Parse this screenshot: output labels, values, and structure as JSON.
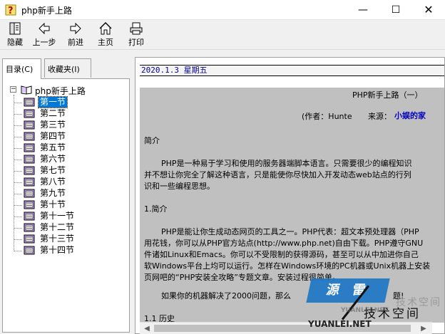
{
  "window": {
    "title": "php新手上路",
    "controls": {
      "minimize": "—",
      "maximize": "☐",
      "close": "✕"
    }
  },
  "toolbar": {
    "items": [
      {
        "label": "隐藏",
        "icon": "hide-pane-icon"
      },
      {
        "label": "上一步",
        "icon": "back-arrow-icon"
      },
      {
        "label": "前进",
        "icon": "forward-arrow-icon"
      },
      {
        "label": "主页",
        "icon": "home-icon"
      },
      {
        "label": "打印",
        "icon": "print-icon"
      }
    ]
  },
  "tabs": {
    "contents": "目录(C)",
    "favorites": "收藏夹(I)"
  },
  "tree": {
    "root": "php新手上路",
    "expander": "−",
    "items": [
      "第一节",
      "第二节",
      "第三节",
      "第四节",
      "第五节",
      "第六节",
      "第七节",
      "第八节",
      "第九节",
      "第十节",
      "第十一节",
      "第十二节",
      "第十三节",
      "第十四节"
    ],
    "selected_index": 0
  },
  "document": {
    "date": "2020.1.3 星期五",
    "heading": "PHP新手上路（一）",
    "author_prefix": "(作者：Hunte",
    "source_prefix": "来源：",
    "source_name": "小娱的家",
    "section_intro_title": "简介",
    "intro_line1": "PHP是一种易于学习和使用的服务器端脚本语言。只需要很少的编程知识",
    "intro_line2": "并不想让你完全了解这种语言，只是能使你尽快加入开发动态web站点的行列",
    "intro_line3": "识和一些编程思想。",
    "section1_title": "1.简介",
    "s1_line1": "PHP是能让你生成动态网页的工具之一。PHP代表：超文本预处理器（PHP",
    "s1_line2": "用花钱，你可以从PHP官方站点(http://www.php.net)自由下载。PHP遵守GNU",
    "s1_line3": "件诸如Linux和Emacs。你可以不受限制的获得源码，甚至可以从中加进你自己",
    "s1_line4": "软Windows平台上均可以运行。怎样在Windows环境的PC机器或Unix机器上安装",
    "s1_line5": "页网吧的“PHP安装全攻略”专题文章。安装过程很简单。",
    "y2k_line": "如果你的机器解决了2000问题，那么",
    "y2k_tail": "题!",
    "section11_title": "1.1 历史"
  },
  "watermark": {
    "brand": "源 雷",
    "sub": "技术空间",
    "main": "技术空间",
    "small": "YUANLEI.NET",
    "url": "YUANLEI.NET"
  },
  "scrollbar": {
    "left": "◀",
    "right": "▶"
  }
}
